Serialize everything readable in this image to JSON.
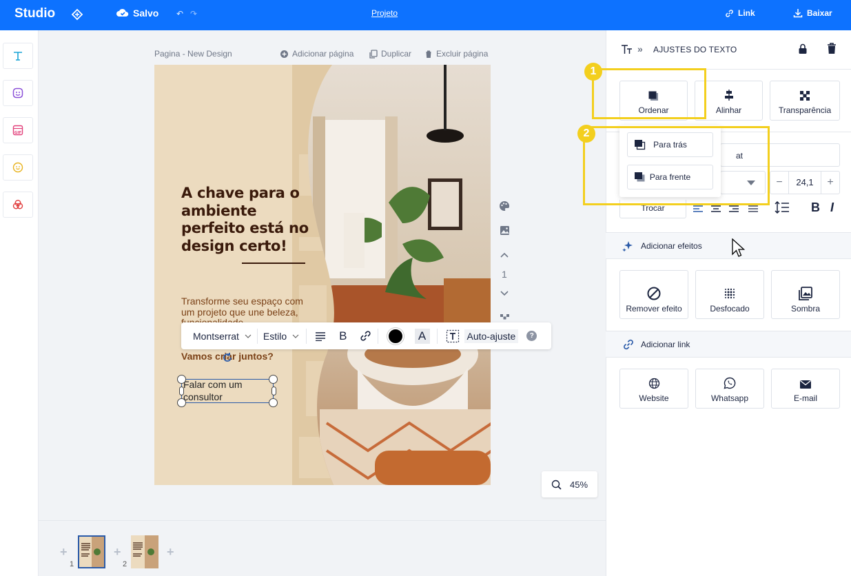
{
  "topbar": {
    "logo": "Studio",
    "saved": "Salvo",
    "project": "Projeto",
    "link": "Link",
    "download": "Baixar"
  },
  "page": {
    "name": "Pagina - New Design",
    "add_page": "Adicionar página",
    "duplicate": "Duplicar",
    "delete_page": "Excluir página"
  },
  "design": {
    "headline": "A chave para o ambiente perfeito está no design certo!",
    "subtitle": "Transforme seu espaço com um projeto que une beleza, funcionalidade",
    "cta": "Vamos criar juntos?",
    "selected_text": "Falar com um consultor"
  },
  "toolbar": {
    "font": "Montserrat",
    "style": "Estilo",
    "bold": "B",
    "text_color_letter": "A",
    "autofit": "Auto-ajuste",
    "help": "?"
  },
  "vertical_tools": {
    "page_number": "1"
  },
  "zoom": {
    "value": "45%"
  },
  "pages": {
    "thumbs": [
      {
        "number": "1"
      },
      {
        "number": "2"
      }
    ]
  },
  "panel": {
    "title": "AJUSTES DO TEXTO",
    "buttons": [
      "Ordenar",
      "Alinhar",
      "Transparência"
    ],
    "order_menu": [
      "Para trás",
      "Para frente"
    ],
    "font_size": "24,1",
    "font_field_suffix": "at",
    "swap": "Trocar",
    "bold": "B",
    "italic": "I",
    "effects_header": "Adicionar efeitos",
    "effects": [
      "Remover efeito",
      "Desfocado",
      "Sombra"
    ],
    "link_header": "Adicionar link",
    "links": [
      "Website",
      "Whatsapp",
      "E-mail"
    ]
  },
  "annotations": [
    "1",
    "2"
  ],
  "colors": {
    "brand": "#0d72ff",
    "highlight": "#f3cf1e",
    "headline": "#3a1a0b",
    "body": "#7b4218"
  }
}
